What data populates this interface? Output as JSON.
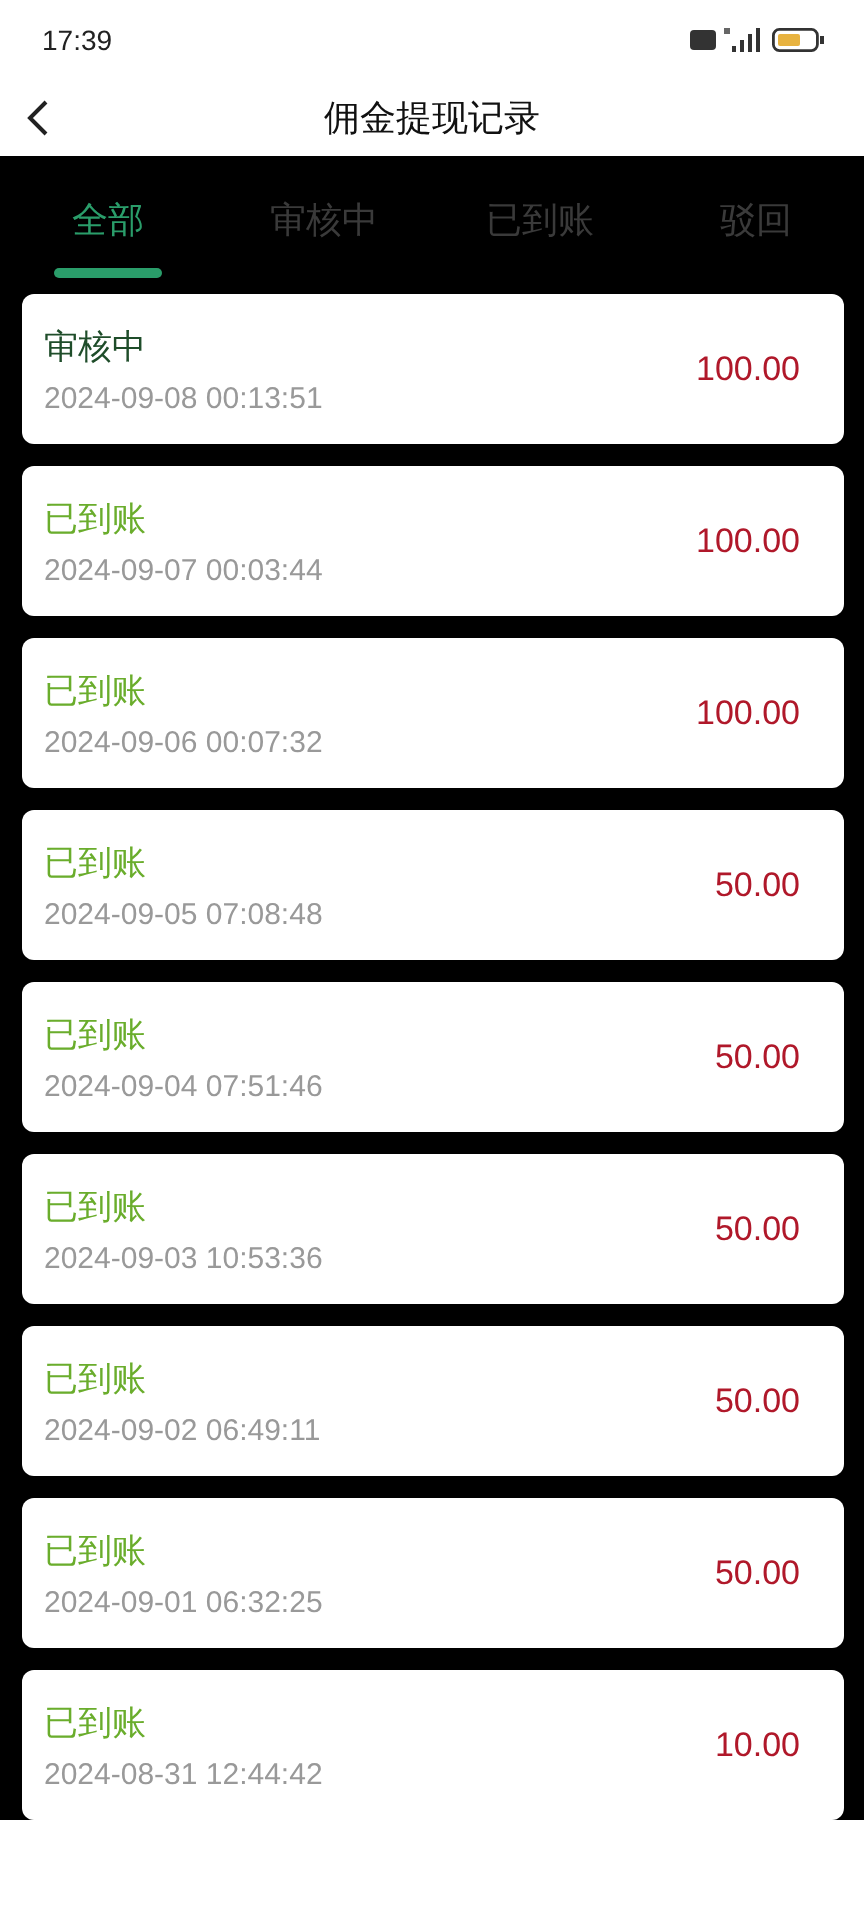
{
  "status_bar": {
    "time": "17:39"
  },
  "header": {
    "title": "佣金提现记录"
  },
  "tabs": [
    {
      "label": "全部",
      "selected": true
    },
    {
      "label": "审核中",
      "selected": false
    },
    {
      "label": "已到账",
      "selected": false
    },
    {
      "label": "驳回",
      "selected": false
    }
  ],
  "records": [
    {
      "status": "审核中",
      "kind": "pending",
      "time": "2024-09-08 00:13:51",
      "amount": "100.00"
    },
    {
      "status": "已到账",
      "kind": "credited",
      "time": "2024-09-07 00:03:44",
      "amount": "100.00"
    },
    {
      "status": "已到账",
      "kind": "credited",
      "time": "2024-09-06 00:07:32",
      "amount": "100.00"
    },
    {
      "status": "已到账",
      "kind": "credited",
      "time": "2024-09-05 07:08:48",
      "amount": "50.00"
    },
    {
      "status": "已到账",
      "kind": "credited",
      "time": "2024-09-04 07:51:46",
      "amount": "50.00"
    },
    {
      "status": "已到账",
      "kind": "credited",
      "time": "2024-09-03 10:53:36",
      "amount": "50.00"
    },
    {
      "status": "已到账",
      "kind": "credited",
      "time": "2024-09-02 06:49:11",
      "amount": "50.00"
    },
    {
      "status": "已到账",
      "kind": "credited",
      "time": "2024-09-01 06:32:25",
      "amount": "50.00"
    },
    {
      "status": "已到账",
      "kind": "credited",
      "time": "2024-08-31 12:44:42",
      "amount": "10.00"
    }
  ]
}
